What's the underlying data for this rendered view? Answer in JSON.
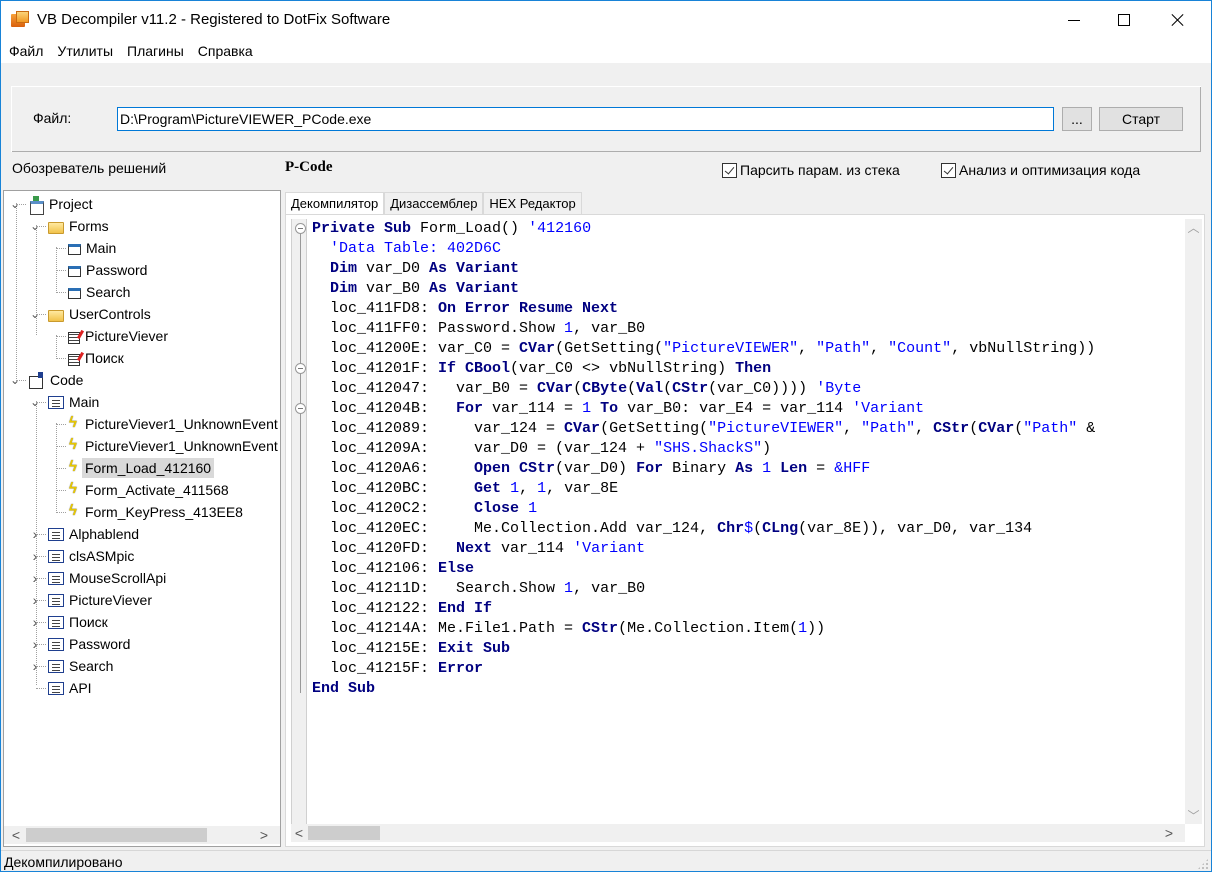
{
  "window": {
    "title": "VB Decompiler v11.2 - Registered to DotFix Software",
    "controls": {
      "minimize": "minimize",
      "maximize": "maximize",
      "close": "close"
    }
  },
  "menu": [
    "Файл",
    "Утилиты",
    "Плагины",
    "Справка"
  ],
  "file_panel": {
    "label": "Файл:",
    "path": "D:\\Program\\PictureVIEWER_PCode.exe",
    "browse_label": "...",
    "start_label": "Старт"
  },
  "solution_explorer": {
    "title": "Обозреватель решений",
    "tree": [
      {
        "label": "Project",
        "icon": "project-icon",
        "level": 0,
        "expanded": true
      },
      {
        "label": "Forms",
        "icon": "folder-icon",
        "level": 1,
        "expanded": true
      },
      {
        "label": "Main",
        "icon": "form-icon",
        "level": 2
      },
      {
        "label": "Password",
        "icon": "form-icon",
        "level": 2
      },
      {
        "label": "Search",
        "icon": "form-icon",
        "level": 2
      },
      {
        "label": "UserControls",
        "icon": "folder-icon",
        "level": 1,
        "expanded": true
      },
      {
        "label": "PictureViever",
        "icon": "usercontrol-icon",
        "level": 2
      },
      {
        "label": "Поиск",
        "icon": "usercontrol-icon",
        "level": 2
      },
      {
        "label": "Code",
        "icon": "code-icon",
        "level": 0,
        "expanded": true
      },
      {
        "label": "Main",
        "icon": "module-icon",
        "level": 1,
        "expanded": true
      },
      {
        "label": "PictureViever1_UnknownEvent",
        "icon": "event-icon",
        "level": 2
      },
      {
        "label": "PictureViever1_UnknownEvent",
        "icon": "event-icon",
        "level": 2
      },
      {
        "label": "Form_Load_412160",
        "icon": "event-icon",
        "level": 2,
        "selected": true
      },
      {
        "label": "Form_Activate_411568",
        "icon": "event-icon",
        "level": 2
      },
      {
        "label": "Form_KeyPress_413EE8",
        "icon": "event-icon",
        "level": 2
      },
      {
        "label": "Alphablend",
        "icon": "module-icon",
        "level": 1,
        "expanded": false
      },
      {
        "label": "clsASMpic",
        "icon": "module-icon",
        "level": 1,
        "expanded": false
      },
      {
        "label": "MouseScrollApi",
        "icon": "module-icon",
        "level": 1,
        "expanded": false
      },
      {
        "label": "PictureViever",
        "icon": "module-icon",
        "level": 1,
        "expanded": false
      },
      {
        "label": "Поиск",
        "icon": "module-icon",
        "level": 1,
        "expanded": false
      },
      {
        "label": "Password",
        "icon": "module-icon",
        "level": 1,
        "expanded": false
      },
      {
        "label": "Search",
        "icon": "module-icon",
        "level": 1,
        "expanded": false
      },
      {
        "label": "API",
        "icon": "module-icon",
        "level": 1
      }
    ]
  },
  "code_view": {
    "mode_title": "P-Code",
    "options": [
      {
        "label": "Парсить парам. из стека",
        "checked": true
      },
      {
        "label": "Анализ и оптимизация кода",
        "checked": true
      }
    ],
    "tabs": [
      {
        "label": "Декомпилятор",
        "active": true
      },
      {
        "label": "Дизассемблер",
        "active": false
      },
      {
        "label": "HEX Редактор",
        "active": false
      }
    ],
    "lines": [
      [
        [
          "kw",
          "Private Sub"
        ],
        [
          "t",
          " Form_Load() "
        ],
        [
          "cmt",
          "'412160"
        ]
      ],
      [
        [
          "t",
          "  "
        ],
        [
          "cmt",
          "'Data Table: 402D6C"
        ]
      ],
      [
        [
          "t",
          "  "
        ],
        [
          "kw",
          "Dim"
        ],
        [
          "t",
          " var_D0 "
        ],
        [
          "kw",
          "As Variant"
        ]
      ],
      [
        [
          "t",
          "  "
        ],
        [
          "kw",
          "Dim"
        ],
        [
          "t",
          " var_B0 "
        ],
        [
          "kw",
          "As Variant"
        ]
      ],
      [
        [
          "t",
          "  loc_411FD8: "
        ],
        [
          "kw",
          "On Error Resume Next"
        ]
      ],
      [
        [
          "t",
          "  loc_411FF0: Password.Show "
        ],
        [
          "num",
          "1"
        ],
        [
          "t",
          ", var_B0"
        ]
      ],
      [
        [
          "t",
          "  loc_41200E: var_C0 = "
        ],
        [
          "kw",
          "CVar"
        ],
        [
          "t",
          "(GetSetting("
        ],
        [
          "str",
          "\"PictureVIEWER\""
        ],
        [
          "t",
          ", "
        ],
        [
          "str",
          "\"Path\""
        ],
        [
          "t",
          ", "
        ],
        [
          "str",
          "\"Count\""
        ],
        [
          "t",
          ", vbNullString))"
        ]
      ],
      [
        [
          "t",
          "  loc_41201F: "
        ],
        [
          "kw",
          "If CBool"
        ],
        [
          "t",
          "(var_C0 <> vbNullString) "
        ],
        [
          "kw",
          "Then"
        ]
      ],
      [
        [
          "t",
          "  loc_412047:   var_B0 = "
        ],
        [
          "kw",
          "CVar"
        ],
        [
          "t",
          "("
        ],
        [
          "kw",
          "CByte"
        ],
        [
          "t",
          "("
        ],
        [
          "kw",
          "Val"
        ],
        [
          "t",
          "("
        ],
        [
          "kw",
          "CStr"
        ],
        [
          "t",
          "(var_C0)))) "
        ],
        [
          "cmt",
          "'Byte"
        ]
      ],
      [
        [
          "t",
          "  loc_41204B:   "
        ],
        [
          "kw",
          "For"
        ],
        [
          "t",
          " var_114 = "
        ],
        [
          "num",
          "1"
        ],
        [
          "t",
          " "
        ],
        [
          "kw",
          "To"
        ],
        [
          "t",
          " var_B0: var_E4 = var_114 "
        ],
        [
          "cmt",
          "'Variant"
        ]
      ],
      [
        [
          "t",
          "  loc_412089:     var_124 = "
        ],
        [
          "kw",
          "CVar"
        ],
        [
          "t",
          "(GetSetting("
        ],
        [
          "str",
          "\"PictureVIEWER\""
        ],
        [
          "t",
          ", "
        ],
        [
          "str",
          "\"Path\""
        ],
        [
          "t",
          ", "
        ],
        [
          "kw",
          "CStr"
        ],
        [
          "t",
          "("
        ],
        [
          "kw",
          "CVar"
        ],
        [
          "t",
          "("
        ],
        [
          "str",
          "\"Path\""
        ],
        [
          "t",
          " &"
        ]
      ],
      [
        [
          "t",
          "  loc_41209A:     var_D0 = (var_124 + "
        ],
        [
          "str",
          "\"SHS.ShackS\""
        ],
        [
          "t",
          ")"
        ]
      ],
      [
        [
          "t",
          "  loc_4120A6:     "
        ],
        [
          "kw",
          "Open CStr"
        ],
        [
          "t",
          "(var_D0) "
        ],
        [
          "kw",
          "For"
        ],
        [
          "t",
          " Binary "
        ],
        [
          "kw",
          "As"
        ],
        [
          "t",
          " "
        ],
        [
          "num",
          "1"
        ],
        [
          "t",
          " "
        ],
        [
          "kw",
          "Len"
        ],
        [
          "t",
          " = "
        ],
        [
          "num",
          "&HFF"
        ]
      ],
      [
        [
          "t",
          "  loc_4120BC:     "
        ],
        [
          "kw",
          "Get"
        ],
        [
          "t",
          " "
        ],
        [
          "num",
          "1"
        ],
        [
          "t",
          ", "
        ],
        [
          "num",
          "1"
        ],
        [
          "t",
          ", var_8E"
        ]
      ],
      [
        [
          "t",
          "  loc_4120C2:     "
        ],
        [
          "kw",
          "Close"
        ],
        [
          "t",
          " "
        ],
        [
          "num",
          "1"
        ]
      ],
      [
        [
          "t",
          "  loc_4120EC:     Me.Collection.Add var_124, "
        ],
        [
          "kw",
          "Chr"
        ],
        [
          "num",
          "$"
        ],
        [
          "t",
          "("
        ],
        [
          "kw",
          "CLng"
        ],
        [
          "t",
          "(var_8E)), var_D0, var_134"
        ]
      ],
      [
        [
          "t",
          "  loc_4120FD:   "
        ],
        [
          "kw",
          "Next"
        ],
        [
          "t",
          " var_114 "
        ],
        [
          "cmt",
          "'Variant"
        ]
      ],
      [
        [
          "t",
          "  loc_412106: "
        ],
        [
          "kw",
          "Else"
        ]
      ],
      [
        [
          "t",
          "  loc_41211D:   Search.Show "
        ],
        [
          "num",
          "1"
        ],
        [
          "t",
          ", var_B0"
        ]
      ],
      [
        [
          "t",
          "  loc_412122: "
        ],
        [
          "kw",
          "End If"
        ]
      ],
      [
        [
          "t",
          "  loc_41214A: Me.File1.Path = "
        ],
        [
          "kw",
          "CStr"
        ],
        [
          "t",
          "(Me.Collection.Item("
        ],
        [
          "num",
          "1"
        ],
        [
          "t",
          "))"
        ]
      ],
      [
        [
          "t",
          "  loc_41215E: "
        ],
        [
          "kw",
          "Exit Sub"
        ]
      ],
      [
        [
          "t",
          "  loc_41215F: "
        ],
        [
          "kw",
          "Error"
        ]
      ],
      [
        [
          "kw",
          "End Sub"
        ]
      ]
    ]
  },
  "status": {
    "text": "Декомпилировано"
  }
}
